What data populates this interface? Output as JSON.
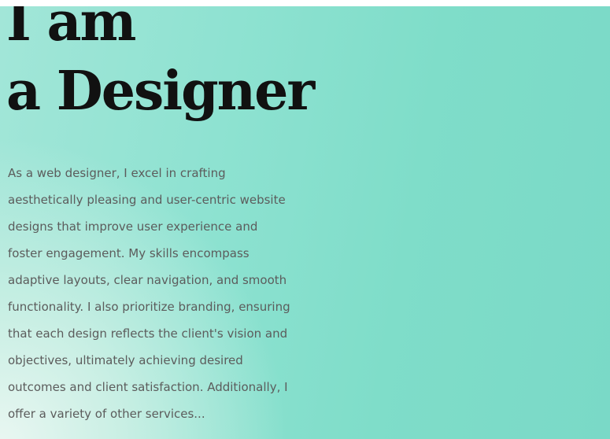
{
  "hero": {
    "heading_line1": "I am",
    "heading_line2": "a Designer",
    "body_lines": [
      "As a web designer, I excel in crafting",
      "aesthetically pleasing and user-centric website",
      "designs that improve user experience and",
      "foster engagement. My skills encompass",
      "adaptive layouts, clear navigation, and smooth",
      "functionality. I also prioritize branding, ensuring",
      "that each design reflects the client's vision and",
      "objectives, ultimately achieving desired",
      "outcomes and client satisfaction. Additionally, I",
      "offer a variety of other services..."
    ]
  },
  "colors": {
    "background_accent": "#7fddc9",
    "heading": "#111111",
    "body": "#5c5c5c"
  }
}
